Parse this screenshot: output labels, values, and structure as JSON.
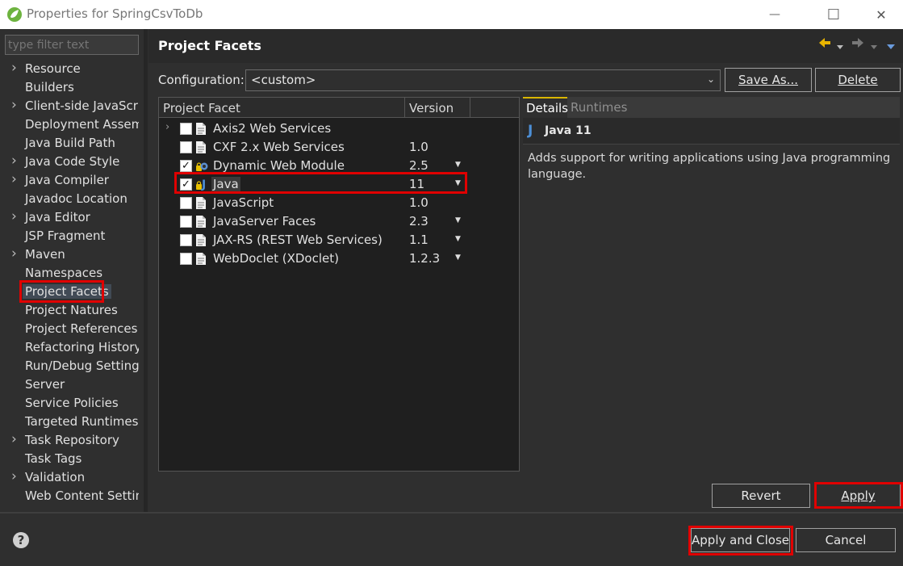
{
  "window": {
    "title": "Properties for SpringCsvToDb",
    "minimize_glyph": "—",
    "maximize_glyph": "☐",
    "close_glyph": "✕"
  },
  "filter": {
    "placeholder": "type filter text"
  },
  "nav": {
    "items": [
      {
        "label": "Resource",
        "expandable": true
      },
      {
        "label": "Builders",
        "expandable": false
      },
      {
        "label": "Client-side JavaScript",
        "expandable": true
      },
      {
        "label": "Deployment Assembly",
        "expandable": false
      },
      {
        "label": "Java Build Path",
        "expandable": false
      },
      {
        "label": "Java Code Style",
        "expandable": true
      },
      {
        "label": "Java Compiler",
        "expandable": true
      },
      {
        "label": "Javadoc Location",
        "expandable": false
      },
      {
        "label": "Java Editor",
        "expandable": true
      },
      {
        "label": "JSP Fragment",
        "expandable": false
      },
      {
        "label": "Maven",
        "expandable": true
      },
      {
        "label": "Namespaces",
        "expandable": false
      },
      {
        "label": "Project Facets",
        "expandable": false,
        "selected": true
      },
      {
        "label": "Project Natures",
        "expandable": false
      },
      {
        "label": "Project References",
        "expandable": false
      },
      {
        "label": "Refactoring History",
        "expandable": false
      },
      {
        "label": "Run/Debug Settings",
        "expandable": false
      },
      {
        "label": "Server",
        "expandable": false
      },
      {
        "label": "Service Policies",
        "expandable": false
      },
      {
        "label": "Targeted Runtimes",
        "expandable": false
      },
      {
        "label": "Task Repository",
        "expandable": true
      },
      {
        "label": "Task Tags",
        "expandable": false
      },
      {
        "label": "Validation",
        "expandable": true
      },
      {
        "label": "Web Content Settings",
        "expandable": false
      }
    ]
  },
  "pane": {
    "title": "Project Facets",
    "configuration_label": "Configuration:",
    "configuration_value": "<custom>",
    "save_as_label": "Save As...",
    "delete_label": "Delete"
  },
  "facets": {
    "col_facet": "Project Facet",
    "col_version": "Version",
    "rows": [
      {
        "name": "Axis2 Web Services",
        "version": "",
        "checked": false,
        "expandable": true,
        "dropdown": false,
        "icon": "doc-icon"
      },
      {
        "name": "CXF 2.x Web Services",
        "version": "1.0",
        "checked": false,
        "expandable": false,
        "dropdown": false,
        "icon": "doc-icon"
      },
      {
        "name": "Dynamic Web Module",
        "version": "2.5",
        "checked": true,
        "expandable": false,
        "dropdown": true,
        "icon": "web-module-icon"
      },
      {
        "name": "Java",
        "version": "11",
        "checked": true,
        "expandable": false,
        "dropdown": true,
        "icon": "java-icon"
      },
      {
        "name": "JavaScript",
        "version": "1.0",
        "checked": false,
        "expandable": false,
        "dropdown": false,
        "icon": "doc-icon"
      },
      {
        "name": "JavaServer Faces",
        "version": "2.3",
        "checked": false,
        "expandable": false,
        "dropdown": true,
        "icon": "doc-icon"
      },
      {
        "name": "JAX-RS (REST Web Services)",
        "version": "1.1",
        "checked": false,
        "expandable": false,
        "dropdown": true,
        "icon": "doc-icon"
      },
      {
        "name": "WebDoclet (XDoclet)",
        "version": "1.2.3",
        "checked": false,
        "expandable": false,
        "dropdown": true,
        "icon": "doc-icon"
      }
    ]
  },
  "details": {
    "tab_details": "Details",
    "tab_runtimes": "Runtimes",
    "title": "Java 11",
    "description": "Adds support for writing applications using Java programming language."
  },
  "buttons": {
    "revert": "Revert",
    "apply": "Apply",
    "apply_and_close": "Apply and Close",
    "cancel": "Cancel"
  },
  "colors": {
    "highlight": "#e00000",
    "accent_yellow": "#d9b600",
    "java_blue": "#4d8fd6"
  }
}
